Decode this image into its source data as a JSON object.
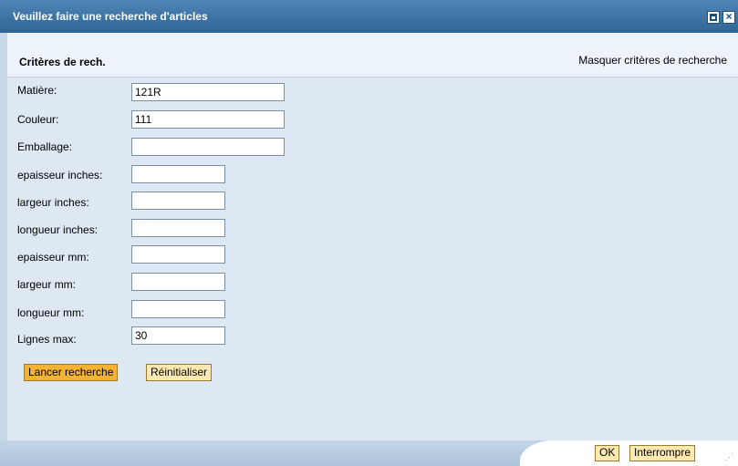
{
  "dialog": {
    "title": "Veuillez faire une recherche d'articles"
  },
  "header": {
    "title": "Critères de rech.",
    "toggle_link": "Masquer critères de recherche"
  },
  "fields": [
    {
      "label": "Matière:",
      "value": "121R"
    },
    {
      "label": "Couleur:",
      "value": "111"
    },
    {
      "label": "Emballage:",
      "value": ""
    },
    {
      "label": "epaisseur inches:",
      "value": ""
    },
    {
      "label": "largeur  inches:",
      "value": ""
    },
    {
      "label": "longueur inches:",
      "value": ""
    },
    {
      "label": "epaisseur  mm:",
      "value": ""
    },
    {
      "label": "largeur  mm:",
      "value": ""
    },
    {
      "label": "longueur  mm:",
      "value": ""
    },
    {
      "label": "Lignes max:",
      "value": "30"
    }
  ],
  "buttons": {
    "search": "Lancer recherche",
    "reset": "Réinitialiser"
  },
  "footer": {
    "ok": "OK",
    "cancel": "Interrompre"
  },
  "icons": {
    "maximize": "maximize-icon",
    "close": "close-icon",
    "resize": "resize-grip-icon"
  },
  "colors": {
    "titlebar": "#2f6596",
    "body": "#dde8f3",
    "primary_button": "#f5b335",
    "secondary_button": "#fde9b0"
  }
}
